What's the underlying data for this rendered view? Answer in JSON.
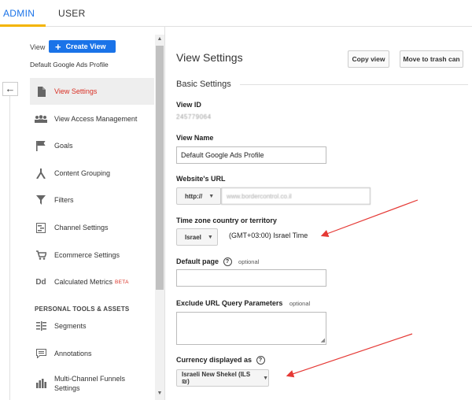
{
  "tabs": {
    "admin": "ADMIN",
    "user": "USER"
  },
  "sidebar": {
    "view_label": "View",
    "create_view": "Create View",
    "profile_name": "Default Google Ads Profile",
    "items": [
      {
        "label": "View Settings",
        "icon": "document-icon"
      },
      {
        "label": "View Access Management",
        "icon": "people-icon"
      },
      {
        "label": "Goals",
        "icon": "flag-icon"
      },
      {
        "label": "Content Grouping",
        "icon": "grouping-icon"
      },
      {
        "label": "Filters",
        "icon": "filter-icon"
      },
      {
        "label": "Channel Settings",
        "icon": "channel-icon"
      },
      {
        "label": "Ecommerce Settings",
        "icon": "cart-icon"
      },
      {
        "label": "Calculated Metrics",
        "icon": "dd-icon",
        "badge": "BETA"
      }
    ],
    "section_title": "PERSONAL TOOLS & ASSETS",
    "personal_items": [
      {
        "label": "Segments",
        "icon": "segments-icon"
      },
      {
        "label": "Annotations",
        "icon": "annotation-icon"
      },
      {
        "label": "Multi-Channel Funnels Settings",
        "icon": "bar-chart-icon"
      }
    ]
  },
  "main": {
    "title": "View Settings",
    "copy_view": "Copy view",
    "move_to_trash": "Move to trash can",
    "basic_settings": "Basic Settings",
    "view_id_label": "View ID",
    "view_id_value": "245779064",
    "view_name_label": "View Name",
    "view_name_value": "Default Google Ads Profile",
    "website_url_label": "Website's URL",
    "protocol": "http://",
    "website_url_value": "www.bordercontrol.co.il",
    "timezone_label": "Time zone country or territory",
    "timezone_country": "Israel",
    "timezone_value": "(GMT+03:00) Israel Time",
    "default_page_label": "Default page",
    "optional": "optional",
    "exclude_label": "Exclude URL Query Parameters",
    "currency_label": "Currency displayed as",
    "currency_value": "Israeli New Shekel (ILS ₪)"
  },
  "colors": {
    "accent": "#1a73e8",
    "active_text": "#d93025",
    "annotation_arrow": "#e53935",
    "tab_underline": "#f4b400"
  }
}
